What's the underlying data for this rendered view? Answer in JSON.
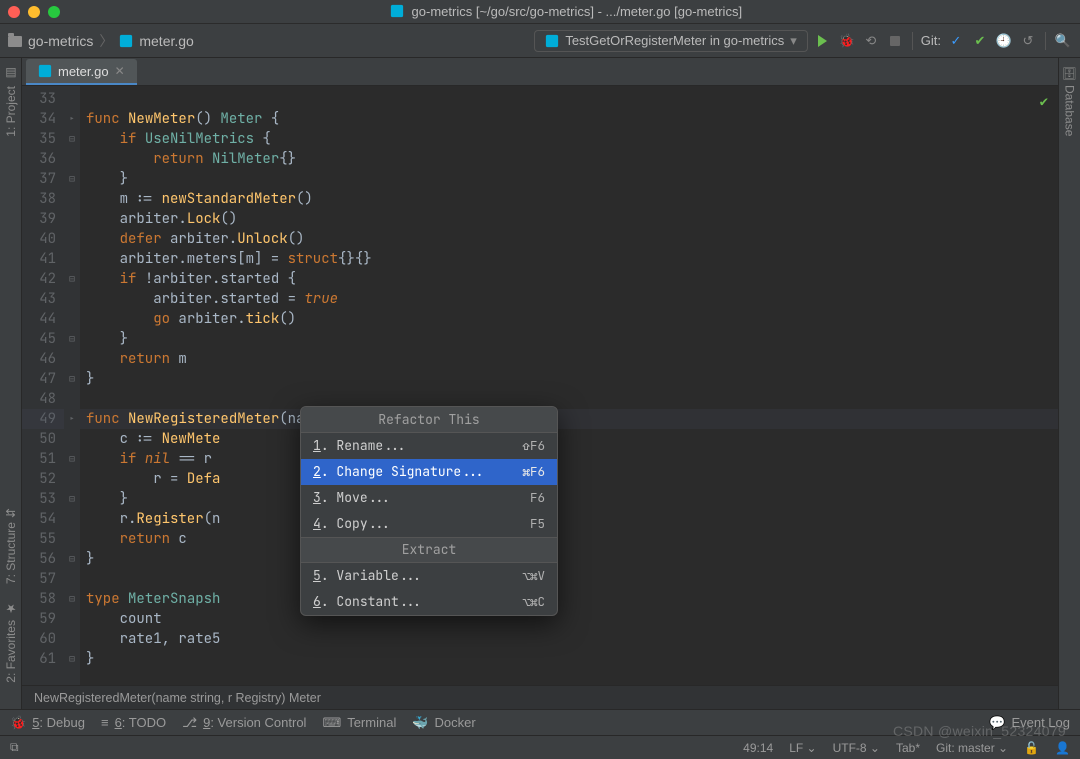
{
  "title": "go-metrics [~/go/src/go-metrics] - .../meter.go [go-metrics]",
  "breadcrumb": {
    "project": "go-metrics",
    "file": "meter.go"
  },
  "runConfig": "TestGetOrRegisterMeter in go-metrics",
  "gitLabel": "Git:",
  "tab": {
    "label": "meter.go"
  },
  "leftPanels": {
    "project": "1: Project",
    "structure": "7: Structure",
    "favorites": "2: Favorites"
  },
  "rightPanels": {
    "database": "Database"
  },
  "codeCrumb": "NewRegisteredMeter(name string, r Registry) Meter",
  "lineStart": 33,
  "codeLines": [
    "",
    "func NewMeter() Meter {",
    "    if UseNilMetrics {",
    "        return NilMeter{}",
    "    }",
    "    m := newStandardMeter()",
    "    arbiter.Lock()",
    "    defer arbiter.Unlock()",
    "    arbiter.meters[m] = struct{}{}",
    "    if !arbiter.started {",
    "        arbiter.started = true",
    "        go arbiter.tick()",
    "    }",
    "    return m",
    "}",
    "",
    "func NewRegisteredMeter(name string, r Registry) Meter {",
    "    c := NewMete",
    "    if nil == r ",
    "        r = Defa",
    "    }",
    "    r.Register(n",
    "    return c",
    "}",
    "",
    "type MeterSnapsh",
    "    count",
    "    rate1, rate5",
    "}"
  ],
  "popup": {
    "title": "Refactor This",
    "items": [
      {
        "n": "1",
        "label": "Rename...",
        "shortcut": "⇧F6"
      },
      {
        "n": "2",
        "label": "Change Signature...",
        "shortcut": "⌘F6",
        "selected": true
      },
      {
        "n": "3",
        "label": "Move...",
        "shortcut": "F6"
      },
      {
        "n": "4",
        "label": "Copy...",
        "shortcut": "F5"
      }
    ],
    "sectionTitle": "Extract",
    "extract": [
      {
        "n": "5",
        "label": "Variable...",
        "shortcut": "⌥⌘V"
      },
      {
        "n": "6",
        "label": "Constant...",
        "shortcut": "⌥⌘C"
      }
    ]
  },
  "bottomTools": {
    "debug": "5: Debug",
    "todo": "6: TODO",
    "version": "9: Version Control",
    "terminal": "Terminal",
    "docker": "Docker",
    "eventLog": "Event Log"
  },
  "statusbar": {
    "pos": "49:14",
    "lineSep": "LF",
    "enc": "UTF-8",
    "tab": "Tab*",
    "gitBranch": "Git: master",
    "lock": "🔓"
  },
  "watermark": "CSDN @weixin_52324079"
}
